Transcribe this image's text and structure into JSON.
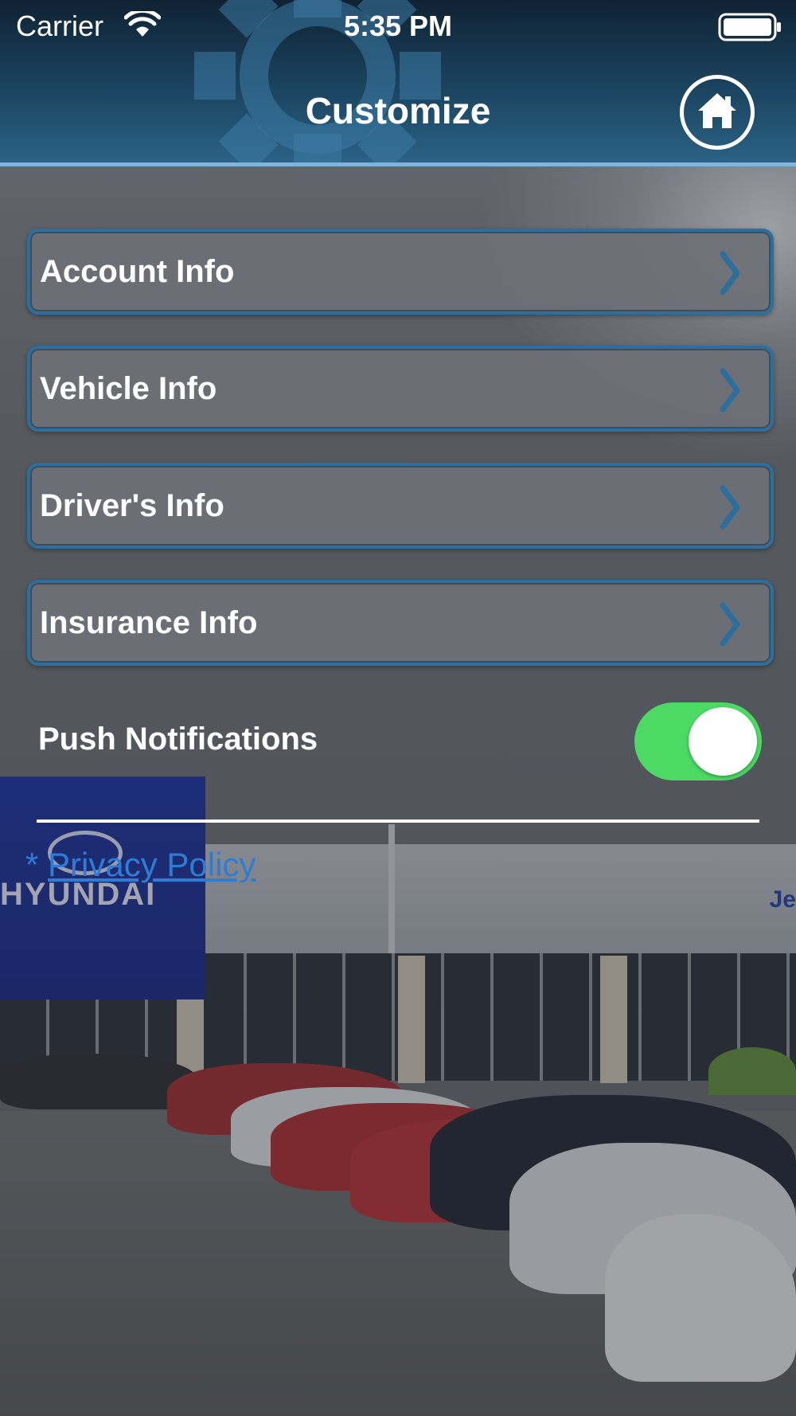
{
  "status_bar": {
    "carrier": "Carrier",
    "time": "5:35 PM",
    "wifi_icon": "wifi-icon",
    "battery_icon": "battery-icon"
  },
  "header": {
    "title": "Customize",
    "home_icon": "home-icon",
    "background_icon": "gear-icon"
  },
  "menu": {
    "items": [
      {
        "label": "Account Info",
        "icon": "chevron-right-icon"
      },
      {
        "label": "Vehicle Info",
        "icon": "chevron-right-icon"
      },
      {
        "label": "Driver's Info",
        "icon": "chevron-right-icon"
      },
      {
        "label": "Insurance Info",
        "icon": "chevron-right-icon"
      }
    ]
  },
  "push_notifications": {
    "label": "Push Notifications",
    "enabled": true
  },
  "privacy": {
    "prefix": "*",
    "link_label": "Privacy Policy"
  },
  "background": {
    "sign_text": "HYUNDAI",
    "dealer_letters": "Je"
  },
  "colors": {
    "header_accent": "#7fb4db",
    "row_border": "#2c6e9e",
    "toggle_on": "#4cd964",
    "link": "#2e7cd6"
  }
}
